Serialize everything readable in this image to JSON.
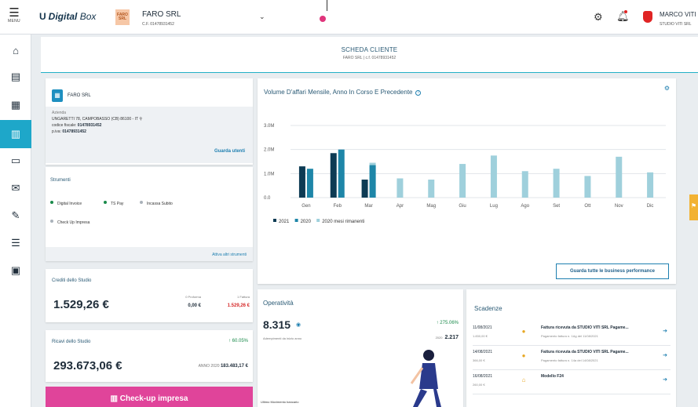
{
  "topbar": {
    "menu_label": "MENU",
    "menu_icon": "hamburger-icon",
    "logo_mark": "U",
    "logo_brand": "Digital",
    "logo_brand_rest": "Box",
    "company_logo_text": "FARO SRL",
    "company_name": "FARO SRL",
    "company_cf": "C.F. 01478931452",
    "user_name": "MARCO VITI",
    "user_studio": "STUDIO VITI SRL",
    "accent_color": "#e0357c"
  },
  "sidebar": {
    "items": [
      {
        "icon": "home-icon",
        "glyph": "⌂"
      },
      {
        "icon": "document-icon",
        "glyph": "▤"
      },
      {
        "icon": "calendar-icon",
        "glyph": "▦"
      },
      {
        "icon": "chart-icon",
        "glyph": "▥",
        "active": true
      },
      {
        "icon": "folder-icon",
        "glyph": "▭"
      },
      {
        "icon": "mail-icon",
        "glyph": "✉"
      },
      {
        "icon": "pen-icon",
        "glyph": "✎"
      },
      {
        "icon": "checklist-icon",
        "glyph": "☰"
      },
      {
        "icon": "clipboard-icon",
        "glyph": "▣"
      }
    ]
  },
  "scheda": {
    "title": "SCHEDA CLIENTE",
    "subtitle": "FARO SRL | c.f. 01478931452"
  },
  "client_card": {
    "name": "FARO SRL",
    "azienda_label": "Azienda",
    "address": "UNGARETTI 78, CAMPOBASSO (CB) 86100 - IT",
    "cf_label": "codice fiscale:",
    "cf_value": "01478931452",
    "piva_label": "p.iva:",
    "piva_value": "01478931452",
    "link": "Guarda utenti"
  },
  "strumenti": {
    "title": "Strumenti",
    "tools": [
      "Digital Invoice",
      "TS Pay",
      "Incassa Subito",
      "Check Up Impresa"
    ],
    "link": "Attiva altri strumenti"
  },
  "crediti": {
    "title": "Crediti dello Studio",
    "amount": "1.529,26 €",
    "proforma_label": "0 Proforma",
    "proforma_value": "0,00 €",
    "fattura_label": "1 Fattura",
    "fattura_value": "1.529,26 €"
  },
  "ricavi": {
    "title": "Ricavi dello Studio",
    "pct": "↑ 60.05%",
    "amount": "293.673,06 €",
    "anno_label": "ANNO 2020",
    "anno_value": "183.483,17 €"
  },
  "checkup_button": "Check-up impresa",
  "chart_card": {
    "title": "Volume D'affari Mensile, Anno In Corso E Precedente",
    "button": "Guarda tutte le business performance"
  },
  "chart_data": {
    "type": "bar",
    "title": "Volume D'affari Mensile, Anno In Corso E Precedente",
    "categories": [
      "Gen",
      "Feb",
      "Mar",
      "Apr",
      "Mag",
      "Giu",
      "Lug",
      "Ago",
      "Set",
      "Ott",
      "Nov",
      "Dic"
    ],
    "y_ticks": [
      "3.0M",
      "2.0M",
      "1.0M",
      "0.0"
    ],
    "ylim": [
      0,
      3.0
    ],
    "grid": true,
    "legend_position": "bottom-left",
    "series": [
      {
        "name": "2021",
        "color": "#0d3b54",
        "values": [
          1.3,
          1.85,
          0.75,
          null,
          null,
          null,
          null,
          null,
          null,
          null,
          null,
          null
        ]
      },
      {
        "name": "2020",
        "color": "#1e86a8",
        "values": [
          1.2,
          2.0,
          1.35,
          null,
          null,
          null,
          null,
          null,
          null,
          null,
          null,
          null
        ]
      },
      {
        "name": "2020 mesi rimanenti",
        "color": "#9fd0dc",
        "values": [
          null,
          null,
          1.45,
          0.8,
          0.75,
          1.4,
          1.75,
          1.1,
          1.2,
          0.9,
          1.7,
          1.05
        ]
      }
    ]
  },
  "operativita": {
    "title": "Operatività",
    "value": "8.315",
    "pct": "↑ 275.06%",
    "subtitle": "Adempimenti da inizio anno",
    "prev_label": "2020",
    "prev_value": "2.217",
    "last": "Ultimo Movimento bancario"
  },
  "scadenze": {
    "title": "Scadenze",
    "rows": [
      {
        "date": "11/08/2021",
        "amount": "1.830,00 €",
        "icon": "person-icon",
        "title": "Fattura ricevuta da STUDIO VITI SRL Pagame...",
        "sub": "Pagamento fattura n. 1Ag del 11/08/2021"
      },
      {
        "date": "14/08/2021",
        "amount": "366,00 €",
        "icon": "person-icon",
        "title": "Fattura ricevuta da STUDIO VITI SRL Pagame...",
        "sub": "Pagamento fattura n. 14a del 14/08/2021"
      },
      {
        "date": "16/08/2021",
        "amount": "260,00 €",
        "icon": "bank-icon",
        "title": "Modello F24",
        "sub": ""
      }
    ]
  }
}
